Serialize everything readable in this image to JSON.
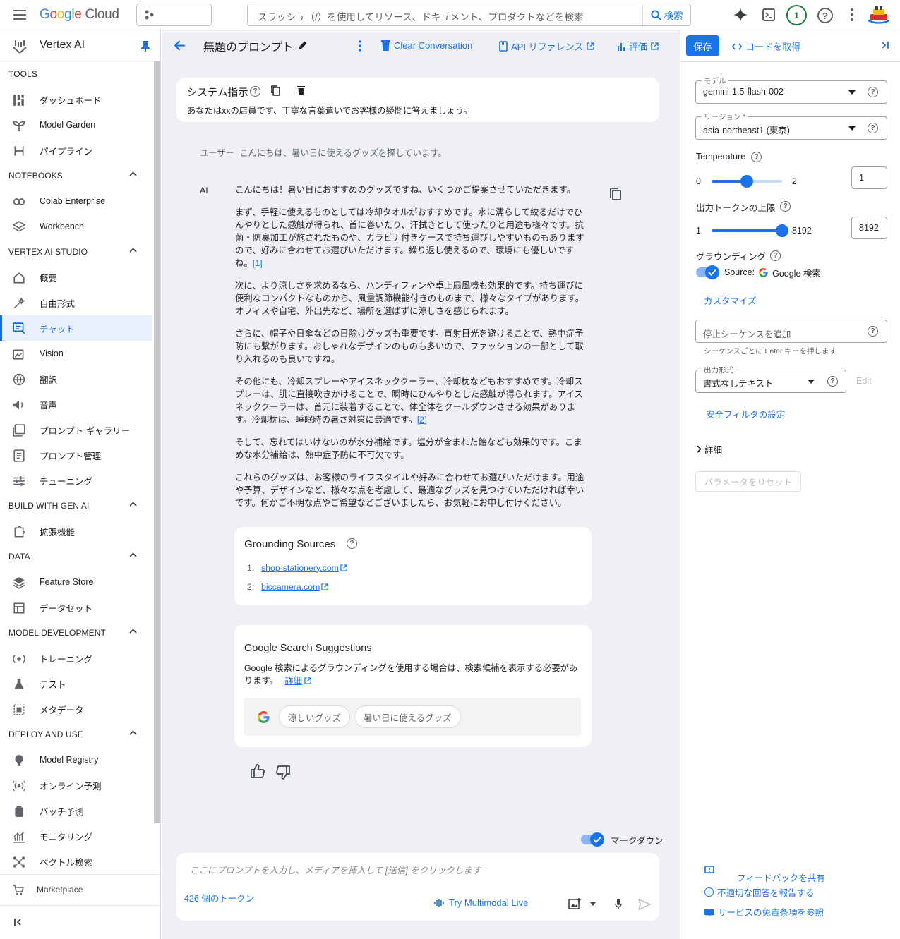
{
  "topbar": {
    "logo_google": "Google",
    "logo_cloud": "Cloud",
    "search_placeholder": "スラッシュ（/）を使用してリソース、ドキュメント、プロダクトなどを検索",
    "search_button": "検索",
    "notification_count": "1"
  },
  "sidebar": {
    "product_name": "Vertex AI",
    "sections": [
      {
        "title": "TOOLS",
        "collapsible": false,
        "items": [
          {
            "label": "ダッシュボード",
            "icon": "dashboard-icon"
          },
          {
            "label": "Model Garden",
            "icon": "model-garden-icon"
          },
          {
            "label": "パイプライン",
            "icon": "pipeline-icon"
          }
        ]
      },
      {
        "title": "NOTEBOOKS",
        "collapsible": true,
        "items": [
          {
            "label": "Colab Enterprise",
            "icon": "colab-icon"
          },
          {
            "label": "Workbench",
            "icon": "workbench-icon"
          }
        ]
      },
      {
        "title": "VERTEX AI STUDIO",
        "collapsible": true,
        "items": [
          {
            "label": "概要",
            "icon": "home-icon"
          },
          {
            "label": "自由形式",
            "icon": "freeform-icon"
          },
          {
            "label": "チャット",
            "icon": "chat-icon",
            "active": true
          },
          {
            "label": "Vision",
            "icon": "vision-icon"
          },
          {
            "label": "翻訳",
            "icon": "translate-icon"
          },
          {
            "label": "音声",
            "icon": "speech-icon"
          },
          {
            "label": "プロンプト ギャラリー",
            "icon": "prompt-gallery-icon"
          },
          {
            "label": "プロンプト管理",
            "icon": "prompt-management-icon"
          },
          {
            "label": "チューニング",
            "icon": "tuning-icon"
          }
        ]
      },
      {
        "title": "BUILD WITH GEN AI",
        "collapsible": true,
        "items": [
          {
            "label": "拡張機能",
            "icon": "extensions-icon"
          }
        ]
      },
      {
        "title": "DATA",
        "collapsible": true,
        "items": [
          {
            "label": "Feature Store",
            "icon": "feature-store-icon"
          },
          {
            "label": "データセット",
            "icon": "dataset-icon"
          }
        ]
      },
      {
        "title": "MODEL DEVELOPMENT",
        "collapsible": true,
        "items": [
          {
            "label": "トレーニング",
            "icon": "training-icon"
          },
          {
            "label": "テスト",
            "icon": "experiments-icon"
          },
          {
            "label": "メタデータ",
            "icon": "metadata-icon"
          }
        ]
      },
      {
        "title": "DEPLOY AND USE",
        "collapsible": true,
        "items": [
          {
            "label": "Model Registry",
            "icon": "model-registry-icon"
          },
          {
            "label": "オンライン予測",
            "icon": "online-prediction-icon"
          },
          {
            "label": "バッチ予測",
            "icon": "batch-prediction-icon"
          },
          {
            "label": "モニタリング",
            "icon": "monitoring-icon"
          },
          {
            "label": "ベクトル検索",
            "icon": "vector-search-icon"
          }
        ]
      }
    ],
    "marketplace": "Marketplace"
  },
  "toolbar": {
    "title": "無題のプロンプト",
    "clear_conversation": "Clear Conversation",
    "api_reference": "API リファレンス",
    "evaluate": "評価"
  },
  "system": {
    "title": "システム指示",
    "text": "あなたはxxの店員です、丁寧な言葉遣いでお客様の疑問に答えましょう。"
  },
  "user_message": {
    "role": "ユーザー",
    "text": "こんにちは、暑い日に使えるグッズを探しています。"
  },
  "ai_message": {
    "role": "AI",
    "paragraphs": [
      {
        "text": "こんにちは！暑い日におすすめのグッズですね、いくつかご提案させていただきます。"
      },
      {
        "text": "まず、手軽に使えるものとしては冷却タオルがおすすめです。水に濡らして絞るだけでひんやりとした感触が得られ、首に巻いたり、汗拭きとして使ったりと用途も様々です。抗菌・防臭加工が施されたものや、カラビナ付きケースで持ち運びしやすいものもありますので、好みに合わせてお選びいただけます。繰り返し使えるので、環境にも優しいです",
        "tail": "ね。",
        "cite": "[1]"
      },
      {
        "text": "次に、より涼しさを求めるなら、ハンディファンや卓上扇風機も効果的です。持ち運びに便利なコンパクトなものから、風量調節機能付きのものまで、様々なタイプがあります。オフィスや自宅、外出先など、場所を選ばずに涼しさを感じられます。"
      },
      {
        "text": "さらに、帽子や日傘などの日除けグッズも重要です。直射日光を避けることで、熱中症予防にも繋がります。おしゃれなデザインのものも多いので、ファッションの一部として取り入れるのも良いですね。"
      },
      {
        "text": "その他にも、冷却スプレーやアイスネッククーラー、冷却枕などもおすすめです。冷却スプレーは、肌に直接吹きかけることで、瞬時にひんやりとした感触が得られます。アイスネッククーラーは、首元に装着することで、体全体をクールダウンさせる効果がありま",
        "tail": "す。冷却枕は、睡眠時の暑さ対策に最適です。",
        "cite": "[2]"
      },
      {
        "text": "そして、忘れてはいけないのが水分補給です。塩分が含まれた飴なども効果的です。こまめな水分補給は、熱中症予防に不可欠です。"
      },
      {
        "text": "これらのグッズは、お客様のライフスタイルや好みに合わせてお選びいただけます。用途や予算、デザインなど、様々な点を考慮して、最適なグッズを見つけていただければ幸いです。何かご不明な点やご希望などございましたら、お気軽にお申し付けください。"
      }
    ]
  },
  "grounding": {
    "title": "Grounding Sources",
    "sources": [
      {
        "num": "1.",
        "label": "shop-stationery.com"
      },
      {
        "num": "2.",
        "label": "biccamera.com"
      }
    ]
  },
  "search_suggestions": {
    "title": "Google Search Suggestions",
    "text": "Google 検索によるグラウンディングを使用する場合は、検索候補を表示する必要があります。",
    "link": "詳細",
    "chips": [
      "涼しいグッズ",
      "暑い日に使えるグッズ"
    ]
  },
  "prompt": {
    "markdown_label": "マークダウン",
    "placeholder": "ここにプロンプトを入力し、メディアを挿入して [送信] をクリックします",
    "tokens": "426 個のトークン",
    "multimodal_live": "Try Multimodal Live"
  },
  "right_panel": {
    "save": "保存",
    "get_code": "コードを取得",
    "model_label": "モデル",
    "model_value": "gemini-1.5-flash-002",
    "region_label": "リージョン *",
    "region_value": "asia-northeast1 (東京)",
    "temperature_label": "Temperature",
    "temperature_min": "0",
    "temperature_max": "2",
    "temperature_value": "1",
    "temperature_fraction": 0.5,
    "tokens_label": "出力トークンの上限",
    "tokens_min": "1",
    "tokens_max": "8192",
    "tokens_value": "8192",
    "tokens_fraction": 1.0,
    "grounding_label": "グラウンディング",
    "grounding_source_prefix": "Source:",
    "grounding_source": "Google 検索",
    "customize": "カスタマイズ",
    "stop_sequence_placeholder": "停止シーケンスを追加",
    "stop_sequence_hint": "シーケンスごとに Enter キーを押します",
    "output_format_label": "出力形式",
    "output_format_value": "書式なしテキスト",
    "edit": "Edit",
    "safety_settings": "安全フィルタの設定",
    "details": "詳細",
    "reset_params": "パラメータをリセット",
    "feedback": "フィードバックを共有",
    "report": "不適切な回答を報告する",
    "terms": "サービスの免責条項を参照"
  },
  "colors": {
    "accent": "#1a73e8",
    "center_bg": "#eef0f5",
    "notification_green": "#188038"
  }
}
